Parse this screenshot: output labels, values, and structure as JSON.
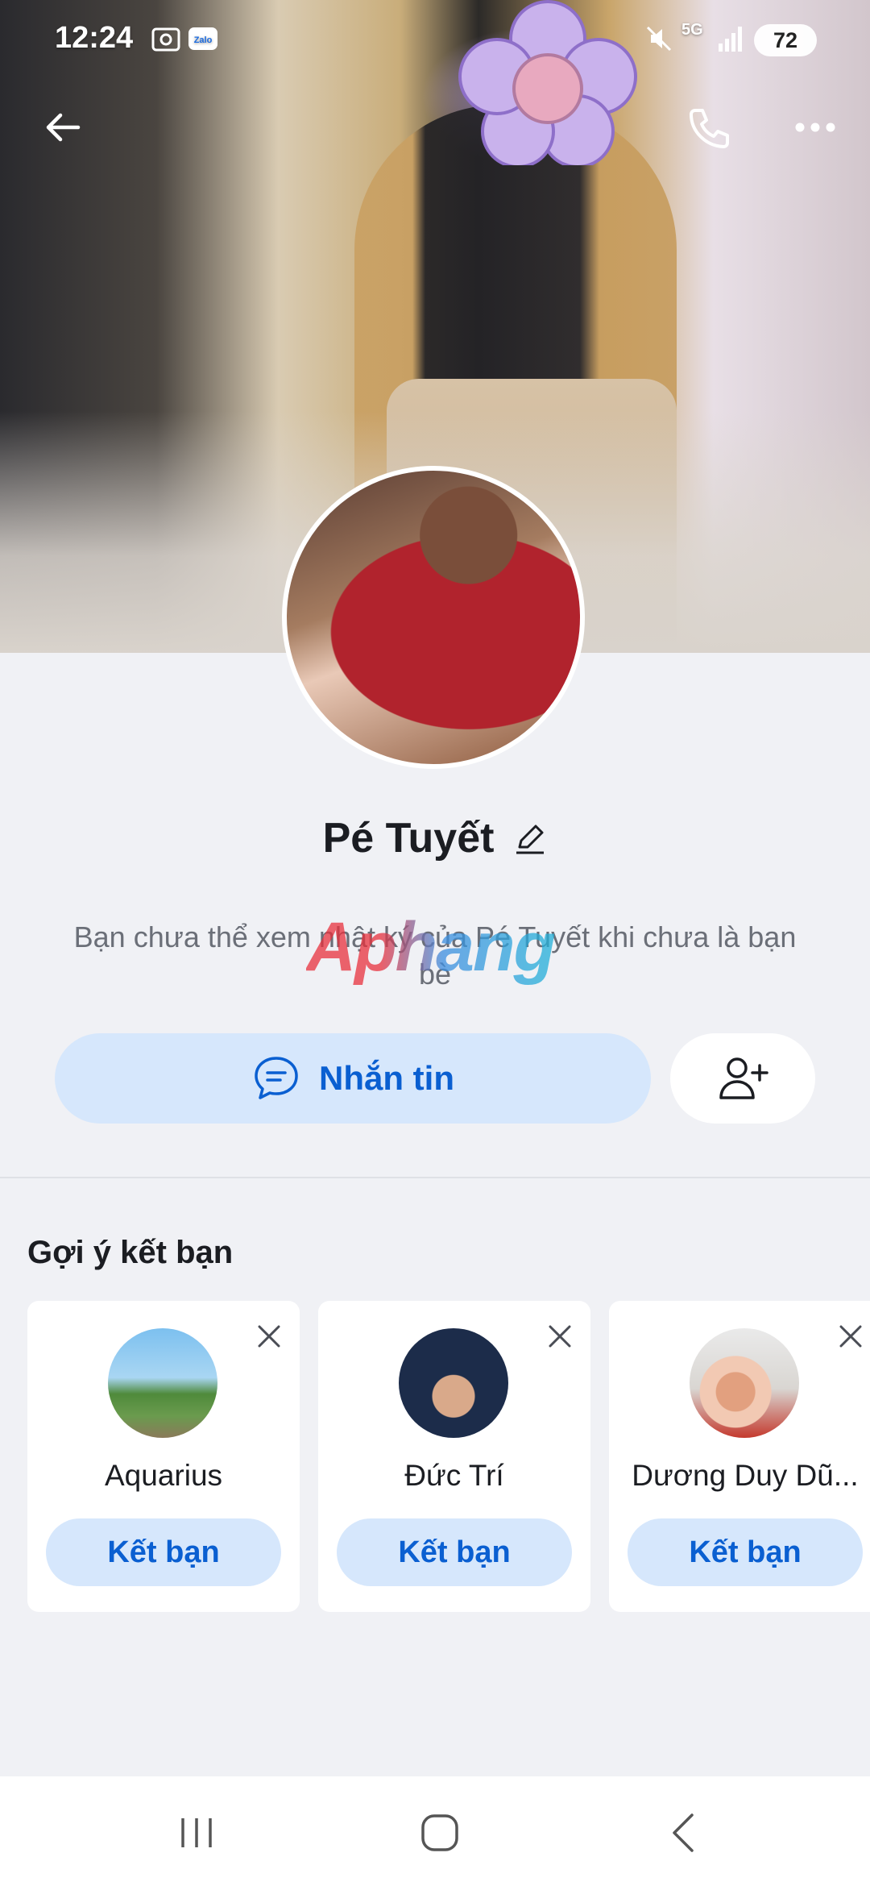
{
  "status_bar": {
    "time": "12:24",
    "battery": "72",
    "network": "5G"
  },
  "top_bar": {
    "back_icon": "arrow-left-icon",
    "call_icon": "phone-icon",
    "more_icon": "more-horizontal-icon"
  },
  "profile": {
    "name": "Pé Tuyết",
    "privacy_note": "Bạn chưa thể xem nhật ký của Pé Tuyết khi chưa là bạn bè",
    "watermark": "Aphang",
    "message_label": "Nhắn tin"
  },
  "suggestions": {
    "title": "Gợi ý kết bạn",
    "items": [
      {
        "name": "Aquarius",
        "button": "Kết bạn"
      },
      {
        "name": "Đức Trí",
        "button": "Kết bạn"
      },
      {
        "name": "Dương Duy Dũ...",
        "button": "Kết bạn"
      }
    ]
  },
  "colors": {
    "accent": "#0a5fd1",
    "accent_soft": "#d6e7fc",
    "background": "#f0f1f5"
  }
}
